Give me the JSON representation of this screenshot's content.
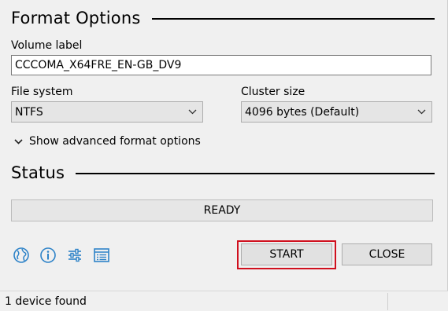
{
  "format_options": {
    "title": "Format Options",
    "volume_label": {
      "label": "Volume label",
      "value": "CCCOMA_X64FRE_EN-GB_DV9"
    },
    "file_system": {
      "label": "File system",
      "selected": "NTFS"
    },
    "cluster_size": {
      "label": "Cluster size",
      "selected": "4096 bytes (Default)"
    },
    "advanced_toggle": "Show advanced format options"
  },
  "status": {
    "title": "Status",
    "progress_text": "READY",
    "progress": 0
  },
  "toolbar": {
    "icons": [
      "globe-icon",
      "info-icon",
      "settings-sliders-icon",
      "log-icon"
    ],
    "accent_color": "#2e83c8"
  },
  "buttons": {
    "start": "START",
    "close": "CLOSE",
    "highlight_color": "#d0101e"
  },
  "statusbar": {
    "text": "1 device found"
  }
}
